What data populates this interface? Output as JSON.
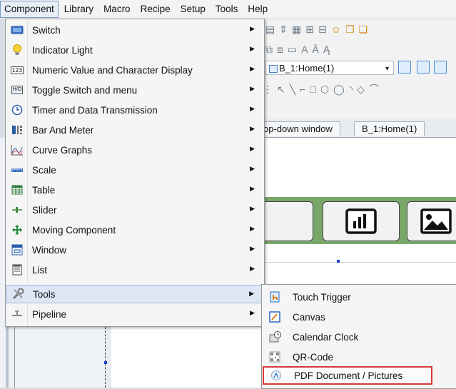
{
  "menubar": {
    "items": [
      {
        "label": "Component",
        "active": true
      },
      {
        "label": "Library"
      },
      {
        "label": "Macro"
      },
      {
        "label": "Recipe"
      },
      {
        "label": "Setup"
      },
      {
        "label": "Tools"
      },
      {
        "label": "Help"
      }
    ]
  },
  "background": {
    "page_combo": "B_1:Home(1)",
    "tabs": [
      "op-down window",
      "B_1:Home(1)"
    ]
  },
  "component_menu": {
    "items": [
      {
        "label": "Switch",
        "icon": "switch-icon"
      },
      {
        "label": "Indicator Light",
        "icon": "bulb-icon"
      },
      {
        "label": "Numeric Value and Character Display",
        "icon": "numeric-display-icon",
        "icon_text": "123"
      },
      {
        "label": "Toggle Switch and menu",
        "icon": "toggle-switch-icon",
        "icon_text": "H/O"
      },
      {
        "label": "Timer and Data Transmission",
        "icon": "clock-icon"
      },
      {
        "label": "Bar And Meter",
        "icon": "bar-meter-icon"
      },
      {
        "label": "Curve Graphs",
        "icon": "curve-graph-icon"
      },
      {
        "label": "Scale",
        "icon": "scale-icon"
      },
      {
        "label": "Table",
        "icon": "table-icon"
      },
      {
        "label": "Slider",
        "icon": "slider-icon"
      },
      {
        "label": "Moving Component",
        "icon": "move-arrows-icon"
      },
      {
        "label": "Window",
        "icon": "window-icon"
      },
      {
        "label": "List",
        "icon": "list-icon"
      },
      {
        "label": "Tools",
        "icon": "tools-icon",
        "highlighted": true
      },
      {
        "label": "Pipeline",
        "icon": "pipeline-icon"
      }
    ]
  },
  "tools_submenu": {
    "items": [
      {
        "label": "Touch Trigger",
        "icon": "touch-trigger-icon"
      },
      {
        "label": "Canvas",
        "icon": "canvas-icon"
      },
      {
        "label": "Calendar  Clock",
        "icon": "calendar-clock-icon"
      },
      {
        "label": "QR-Code",
        "icon": "qr-code-icon"
      },
      {
        "label": "PDF Document / Pictures",
        "icon": "pdf-icon",
        "boxed": true
      }
    ]
  },
  "colors": {
    "highlight_bg": "#dce6f4",
    "red_box": "#d63a3a",
    "ribbon_green": "#79a76a"
  }
}
